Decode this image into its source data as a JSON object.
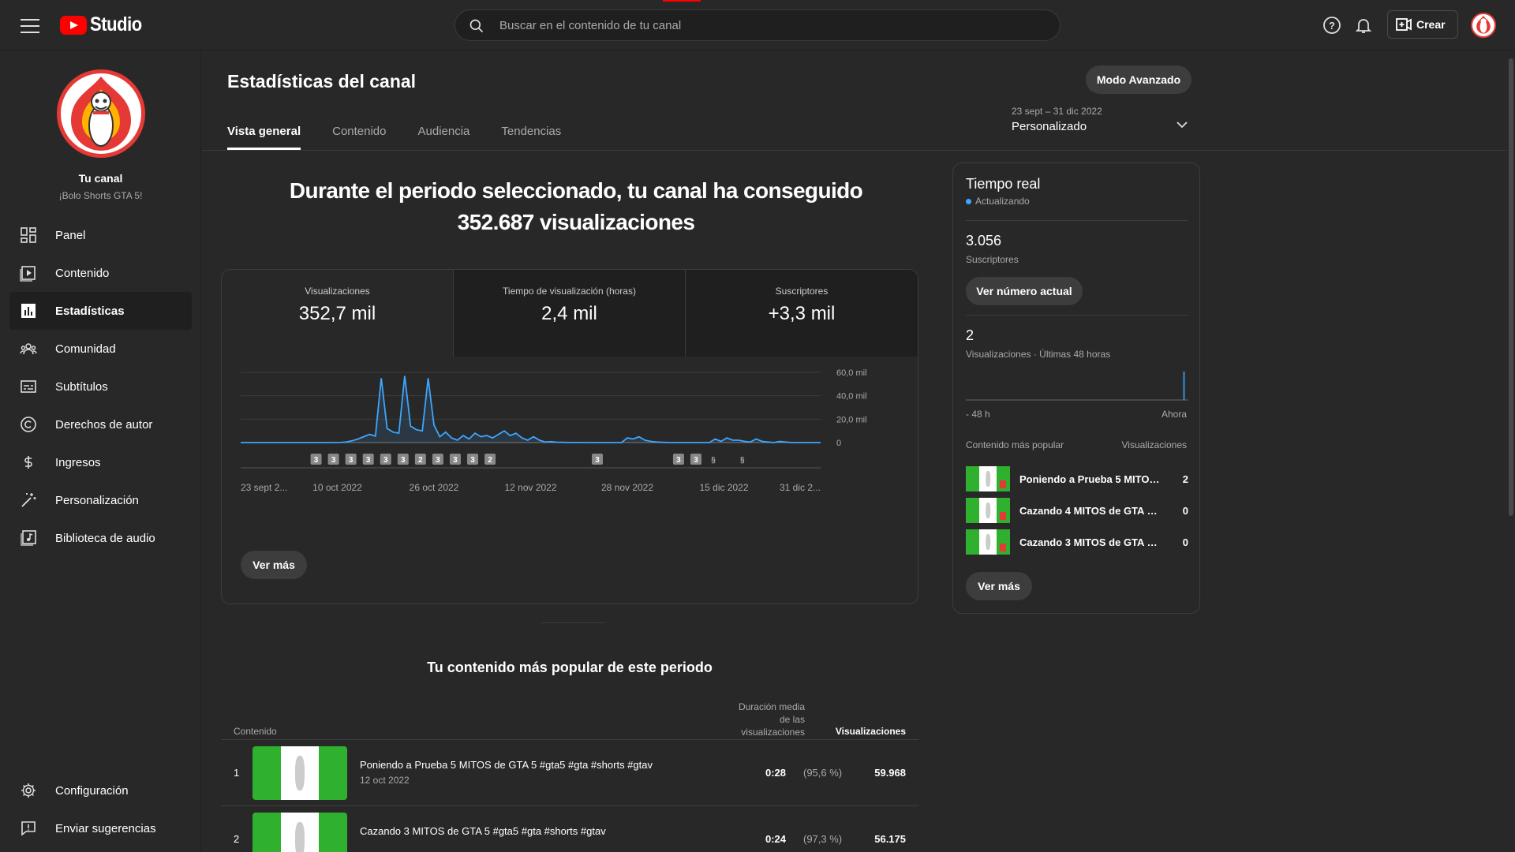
{
  "header": {
    "app_name": "Studio",
    "search_placeholder": "Buscar en el contenido de tu canal",
    "create_label": "Crear"
  },
  "sidebar": {
    "channel_title": "Tu canal",
    "channel_name": "¡Bolo Shorts GTA 5!",
    "items": [
      {
        "label": "Panel",
        "icon": "dashboard-icon"
      },
      {
        "label": "Contenido",
        "icon": "content-icon"
      },
      {
        "label": "Estadísticas",
        "icon": "analytics-icon",
        "active": true
      },
      {
        "label": "Comunidad",
        "icon": "community-icon"
      },
      {
        "label": "Subtítulos",
        "icon": "subtitles-icon"
      },
      {
        "label": "Derechos de autor",
        "icon": "copyright-icon"
      },
      {
        "label": "Ingresos",
        "icon": "dollar-icon"
      },
      {
        "label": "Personalización",
        "icon": "magic-wand-icon"
      },
      {
        "label": "Biblioteca de audio",
        "icon": "audio-library-icon"
      }
    ],
    "bottom_items": [
      {
        "label": "Configuración",
        "icon": "gear-icon"
      },
      {
        "label": "Enviar sugerencias",
        "icon": "feedback-icon"
      }
    ]
  },
  "main": {
    "title": "Estadísticas del canal",
    "advanced_mode_label": "Modo Avanzado",
    "tabs": [
      {
        "label": "Vista general",
        "active": true
      },
      {
        "label": "Contenido"
      },
      {
        "label": "Audiencia"
      },
      {
        "label": "Tendencias"
      }
    ],
    "date_range": "23 sept – 31 dic 2022",
    "date_label": "Personalizado",
    "headline_line1": "Durante el periodo seleccionado, tu canal ha conseguido",
    "headline_line2": "352.687 visualizaciones",
    "metrics": [
      {
        "label": "Visualizaciones",
        "value": "352,7 mil"
      },
      {
        "label": "Tiempo de visualización (horas)",
        "value": "2,4 mil"
      },
      {
        "label": "Suscriptores",
        "value": "+3,3 mil"
      }
    ],
    "see_more_label": "Ver más"
  },
  "chart_data": {
    "type": "line",
    "ylim": [
      0,
      60000
    ],
    "y_ticks": [
      "60,0 mil",
      "40,0 mil",
      "20,0 mil",
      "0"
    ],
    "x_tick_labels": [
      "23 sept 2...",
      "10 oct 2022",
      "26 oct 2022",
      "12 nov 2022",
      "28 nov 2022",
      "15 dic 2022",
      "31 dic 2..."
    ],
    "series": [
      {
        "values": [
          0,
          0,
          0,
          0,
          0,
          0,
          0,
          0,
          0,
          0,
          0,
          0,
          0,
          0,
          0,
          0,
          0,
          100,
          500,
          1500,
          3000,
          5000,
          7000,
          5500,
          55000,
          12000,
          9000,
          8000,
          57000,
          14000,
          11000,
          10000,
          55000,
          15000,
          5000,
          9000,
          4000,
          2000,
          6000,
          3000,
          8000,
          5000,
          6000,
          4000,
          7000,
          10000,
          6000,
          8000,
          4000,
          2000,
          5000,
          2000,
          500,
          800,
          300,
          200,
          100,
          100,
          100,
          0,
          0,
          0,
          0,
          0,
          0,
          0,
          4000,
          3000,
          5000,
          2000,
          1000,
          500,
          200,
          0,
          0,
          0,
          0,
          0,
          0,
          0,
          0,
          3000,
          1000,
          4000,
          2000,
          2000,
          1000,
          500,
          3000,
          1000,
          500,
          0,
          1000,
          500,
          0,
          0,
          0,
          0,
          0,
          0
        ],
        "color": "#3ea6ff"
      }
    ],
    "markers": [
      {
        "pos": 0.13,
        "label": "3"
      },
      {
        "pos": 0.16,
        "label": "3"
      },
      {
        "pos": 0.19,
        "label": "3"
      },
      {
        "pos": 0.22,
        "label": "3"
      },
      {
        "pos": 0.25,
        "label": "3"
      },
      {
        "pos": 0.28,
        "label": "3"
      },
      {
        "pos": 0.31,
        "label": "2"
      },
      {
        "pos": 0.34,
        "label": "3"
      },
      {
        "pos": 0.37,
        "label": "3"
      },
      {
        "pos": 0.4,
        "label": "3"
      },
      {
        "pos": 0.43,
        "label": "2"
      },
      {
        "pos": 0.615,
        "label": "3"
      },
      {
        "pos": 0.755,
        "label": "3"
      },
      {
        "pos": 0.785,
        "label": "3"
      },
      {
        "pos": 0.815,
        "label": "S"
      },
      {
        "pos": 0.865,
        "label": "S"
      }
    ]
  },
  "realtime": {
    "title": "Tiempo real",
    "status": "Actualizando",
    "subscribers_value": "3.056",
    "subscribers_label": "Suscriptores",
    "see_current_label": "Ver número actual",
    "views_value": "2",
    "views_label": "Visualizaciones · Últimas 48 horas",
    "axis_start": "- 48 h",
    "axis_end": "Ahora",
    "popular_header": "Contenido más popular",
    "views_header": "Visualizaciones",
    "rows": [
      {
        "title": "Poniendo a Prueba 5 MITOS ...",
        "views": "2"
      },
      {
        "title": "Cazando 4 MITOS de GTA 5 #...",
        "views": "0"
      },
      {
        "title": "Cazando 3 MITOS de GTA 5 #...",
        "views": "0"
      }
    ],
    "see_more_label": "Ver más"
  },
  "top_content": {
    "title": "Tu contenido más popular de este periodo",
    "col_content": "Contenido",
    "col_duration_1": "Duración media",
    "col_duration_2": "de las",
    "col_duration_3": "visualizaciones",
    "col_views": "Visualizaciones",
    "rows": [
      {
        "index": "1",
        "title": "Poniendo a Prueba 5 MITOS de GTA 5 #gta5 #gta #shorts #gtav",
        "date": "12 oct 2022",
        "duration": "0:28",
        "percent": "(95,6 %)",
        "views": "59.968"
      },
      {
        "index": "2",
        "title": "Cazando 3 MITOS de GTA 5 #gta5 #gta #shorts #gtav",
        "date": "",
        "duration": "0:24",
        "percent": "(97,3 %)",
        "views": "56.175"
      }
    ]
  }
}
